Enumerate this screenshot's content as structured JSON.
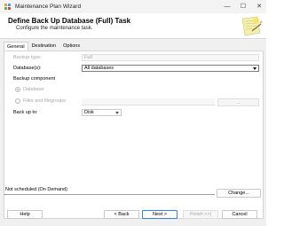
{
  "window": {
    "title": "Maintenance Plan Wizard",
    "minimize_glyph": "—",
    "maximize_glyph": "☐",
    "close_glyph": "✕"
  },
  "header": {
    "title": "Define Back Up Database (Full) Task",
    "subtitle": "Configure the maintenance task."
  },
  "tabs": [
    {
      "label": "General",
      "active": true
    },
    {
      "label": "Destination",
      "active": false
    },
    {
      "label": "Options",
      "active": false
    }
  ],
  "general": {
    "backup_type_label": "Backup type:",
    "backup_type_value": "Full",
    "databases_label": "Database(s):",
    "databases_value": "All databases",
    "backup_component_label": "Backup component",
    "database_radio_label": "Database",
    "files_radio_label": "Files and filegroups:",
    "files_button_label": "...",
    "back_up_to_label": "Back up to:",
    "back_up_to_value": "Disk"
  },
  "schedule": {
    "text": "Not scheduled (On Demand)",
    "change_label": "Change..."
  },
  "footer": {
    "help_label": "Help",
    "back_label": "< Back",
    "next_label": "Next >",
    "finish_label": "Finish >>|",
    "cancel_label": "Cancel"
  },
  "colors": {
    "accent": "#3b7fd9",
    "disabled_text": "#a6a6a6",
    "background": "#f0f0f0"
  },
  "icons": {
    "app": "wizard-app-icon",
    "header_art": "wizard-illustration-icon"
  }
}
